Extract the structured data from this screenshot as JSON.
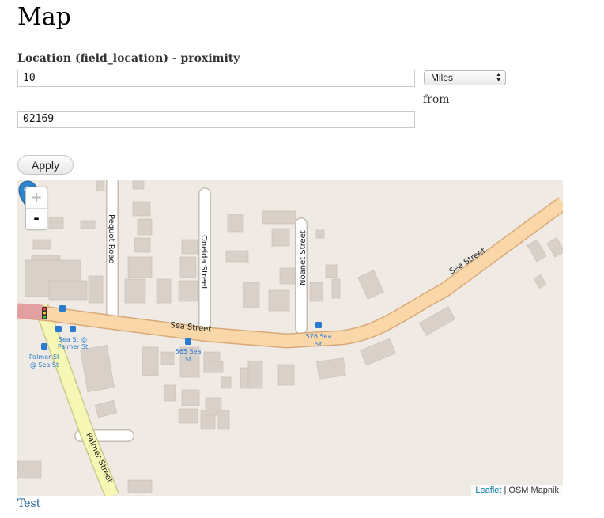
{
  "page": {
    "title": "Map"
  },
  "form": {
    "field_label": "Location (field_location) - proximity",
    "distance_value": "10",
    "unit_selected": "Miles",
    "from_label": "from",
    "postal_code_value": "02169",
    "apply_label": "Apply"
  },
  "map": {
    "zoom_in": "+",
    "zoom_out": "-",
    "attribution_link": "Leaflet",
    "attribution_rest": "| OSM Mapnik",
    "street_labels": [
      "Pequot Road",
      "Oneida Street",
      "Noanet Street",
      "Sea Street",
      "Sea Street",
      "Palmer Street"
    ],
    "stop_labels": [
      [
        "Sea St @",
        "Palmer St"
      ],
      [
        "Palmer St",
        "@ Sea St"
      ],
      [
        "565 Sea",
        "St"
      ],
      [
        "576 Sea",
        "St"
      ]
    ],
    "colors": {
      "background": "#efebe4",
      "building": "#d9d0c9",
      "major_road": "#f9d7a8",
      "secondary_road": "#f7f7b5",
      "marker": "#2f84cb"
    }
  },
  "footer": {
    "link": "Test"
  }
}
